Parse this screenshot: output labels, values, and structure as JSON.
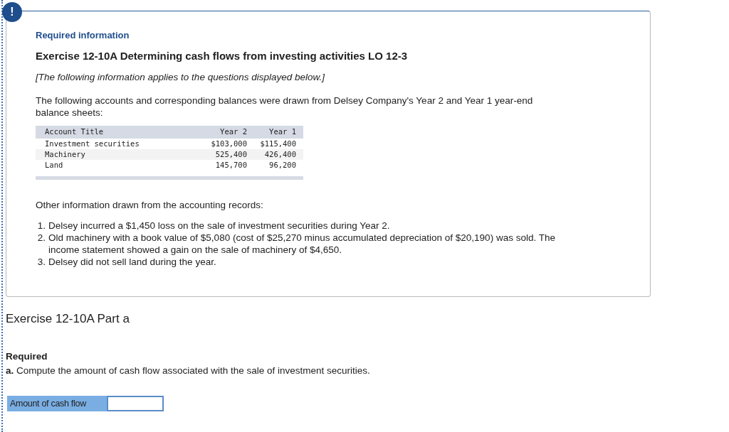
{
  "alert_icon": "!",
  "info": {
    "heading": "Required information",
    "title": "Exercise 12-10A Determining cash flows from investing activities LO 12-3",
    "note": "[The following information applies to the questions displayed below.]",
    "intro": "The following accounts and corresponding balances were drawn from Delsey Company's Year 2 and Year 1 year-end balance sheets:",
    "table": {
      "columns": [
        "Account Title",
        "Year 2",
        "Year 1"
      ],
      "rows": [
        [
          "Investment securities",
          "$103,000",
          "$115,400"
        ],
        [
          "Machinery",
          "525,400",
          "426,400"
        ],
        [
          "Land",
          "145,700",
          "96,200"
        ]
      ]
    },
    "other_heading": "Other information drawn from the accounting records:",
    "items": [
      {
        "number": "1.",
        "text": "Delsey incurred a $1,450 loss on the sale of investment securities during Year 2."
      },
      {
        "number": "2.",
        "text": "Old machinery with a book value of $5,080 (cost of $25,270 minus accumulated depreciation of $20,190) was sold. The income statement showed a gain on the sale of machinery of $4,650."
      },
      {
        "number": "3.",
        "text": "Delsey did not sell land during the year."
      }
    ]
  },
  "part_title": "Exercise 12-10A Part a",
  "required": {
    "label": "Required",
    "question": "**a.** Compute the amount of cash flow associated with the sale of investment securities."
  },
  "answer": {
    "label": "Amount of cash flow"
  }
}
